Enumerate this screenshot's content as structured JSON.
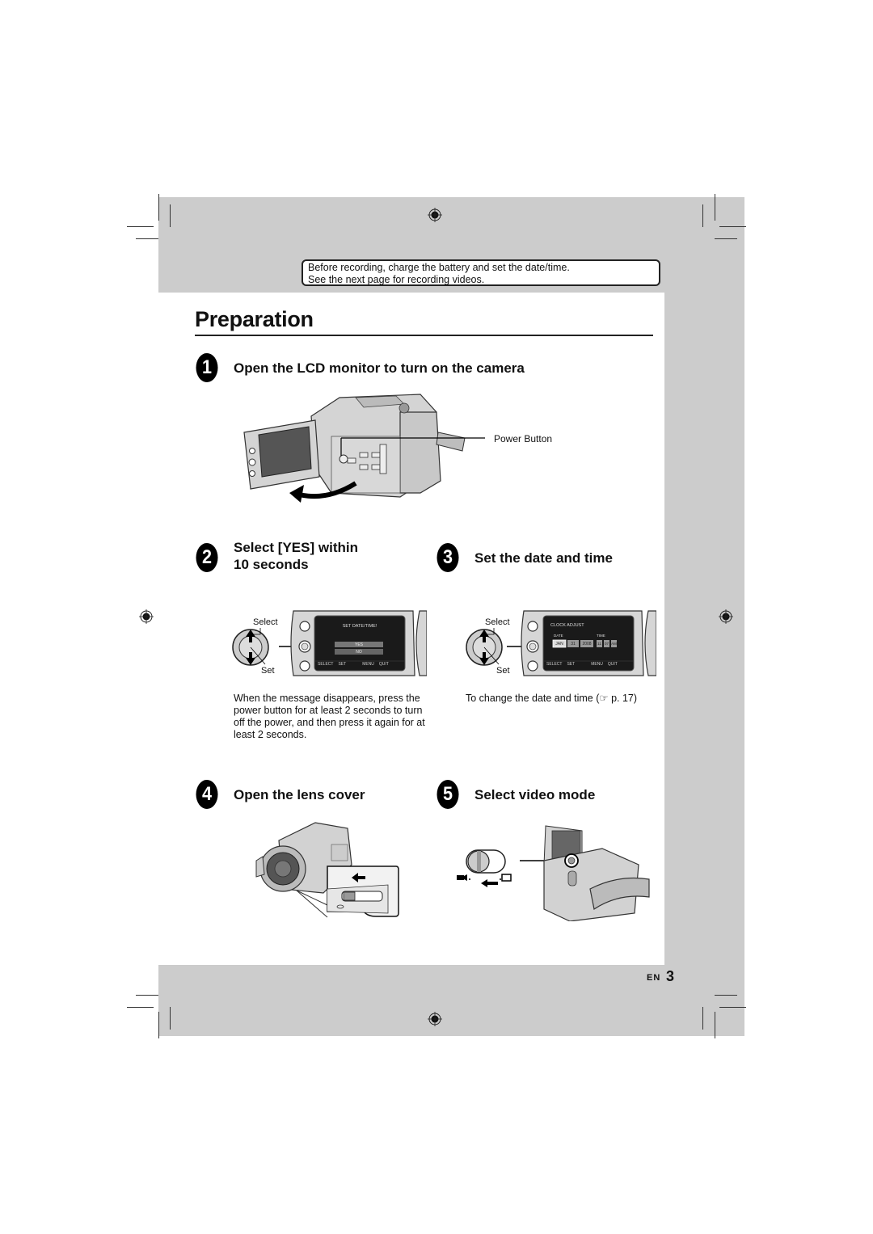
{
  "note_box": {
    "line1": "Before recording, charge the battery and set the date/time.",
    "line2": "See the next page for recording videos."
  },
  "page_title": "Preparation",
  "steps": [
    {
      "number": "1",
      "heading": "Open the LCD monitor to turn on the camera",
      "callout": "Power Button"
    },
    {
      "number": "2",
      "heading_line1": "Select [YES] within",
      "heading_line2": "10 seconds",
      "dpad_labels": {
        "select": "Select",
        "set": "Set"
      },
      "screen": {
        "title": "SET DATE/TIME!",
        "options": [
          "YES",
          "NO"
        ],
        "footer": {
          "select": "SELECT",
          "set": "SET",
          "menu": "MENU",
          "quit": "QUIT"
        }
      },
      "note": "When the message disappears, press the power button for at least 2 seconds to turn off the power, and then press it again for at least 2 seconds."
    },
    {
      "number": "3",
      "heading": "Set the date and time",
      "dpad_labels": {
        "select": "Select",
        "set": "Set"
      },
      "screen": {
        "title": "CLOCK ADJUST",
        "date_label": "DATE",
        "time_label": "TIME",
        "date_fields": [
          "JAN",
          "31",
          "2008"
        ],
        "time_fields": [
          "11",
          "07",
          "AM"
        ],
        "footer": {
          "select": "SELECT",
          "set": "SET",
          "menu": "MENU",
          "quit": "QUIT"
        }
      },
      "note": "To change the date and time (☞ p. 17)"
    },
    {
      "number": "4",
      "heading": "Open the lens cover"
    },
    {
      "number": "5",
      "heading": "Select video mode"
    }
  ],
  "footer": {
    "lang": "EN",
    "page": "3"
  }
}
